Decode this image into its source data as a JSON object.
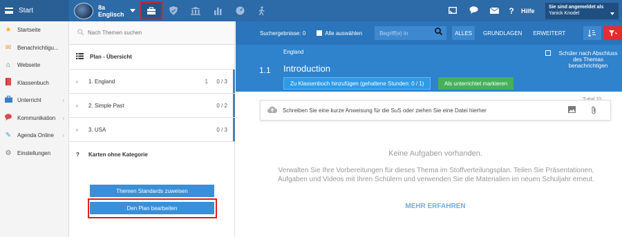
{
  "topbar": {
    "start_label": "Start",
    "class_name_line1": "8a",
    "class_name_line2": "Englisch",
    "help_label": "Hilfe",
    "user_status": "Sie sind angemeldet als",
    "user_name": "Yanick Knodel",
    "nav_icons": [
      "briefcase-icon",
      "shield-icon",
      "building-icon",
      "chart-icon",
      "gauge-icon",
      "walk-icon"
    ],
    "right_icons": [
      "cast-icon",
      "chat-icon",
      "mail-icon",
      "help-icon"
    ]
  },
  "sidebar": {
    "items": [
      {
        "label": "Startseite",
        "icon": "star-icon",
        "color": "#f2b01e"
      },
      {
        "label": "Benachrichtigu...",
        "icon": "mail-icon",
        "color": "#f08a24"
      },
      {
        "label": "Webseite",
        "icon": "home-icon",
        "color": "#2e8b57"
      },
      {
        "label": "Klassenbuch",
        "icon": "book-icon",
        "color": "#e14b4b"
      },
      {
        "label": "Unterricht",
        "icon": "briefcase-icon",
        "color": "#3b7dc4"
      },
      {
        "label": "Kommunikation",
        "icon": "chat-icon",
        "color": "#d94b4b"
      },
      {
        "label": "Agenda Online",
        "icon": "pen-icon",
        "color": "#3aa0d6"
      },
      {
        "label": "Einstellungen",
        "icon": "gear-icon",
        "color": "#777777"
      }
    ]
  },
  "themes": {
    "search_placeholder": "Nach Themen suchen",
    "plan_title": "Plan - Übersicht",
    "topics": [
      {
        "label": "1. England",
        "count": "1",
        "progress": "0 / 3"
      },
      {
        "label": "2. Simple Past",
        "count": "",
        "progress": "0 / 2"
      },
      {
        "label": "3. USA",
        "count": "",
        "progress": "0 / 3"
      }
    ],
    "no_category_marker": "?",
    "no_category": "Karten ohne Kategorie",
    "assign_button": "Themen Standards zuweisen",
    "edit_button": "Den Plan bearbeiten"
  },
  "toolbar": {
    "results": "Suchergebnisse: 0",
    "select_all": "Alle auswählen",
    "term_placeholder": "Begriff(e) in",
    "filters": [
      "ALLES",
      "GRUNDLAGEN",
      "ERWEITERT"
    ]
  },
  "topic": {
    "country": "England",
    "number": "1.1",
    "title": "Introduction",
    "add_button": "Zu Klassenbuch hinzufügen (gehaltene Stunden: 0 / 1)",
    "mark_button": "Als unterrichtet markieren",
    "notify_label": "Schüler nach Abschluss des Themas benachrichtigen",
    "side_label": "Tuttal 10"
  },
  "content": {
    "upload_placeholder": "Schreiben Sie eine kurze Anweisung für die SuS oder ziehen Sie eine Datei hierher",
    "empty_title": "Keine Aufgaben vorhanden.",
    "empty_desc": "Verwalten Sie Ihre Vorbereitungen für dieses Thema im Stoffverteilungsplan. Teilen Sie Präsentationen, Aufgaben und Videos mit Ihren Schülern und verwenden Sie die Materialien im neuen Schuljahr erneut.",
    "learn_more": "MEHR ERFAHREN"
  }
}
